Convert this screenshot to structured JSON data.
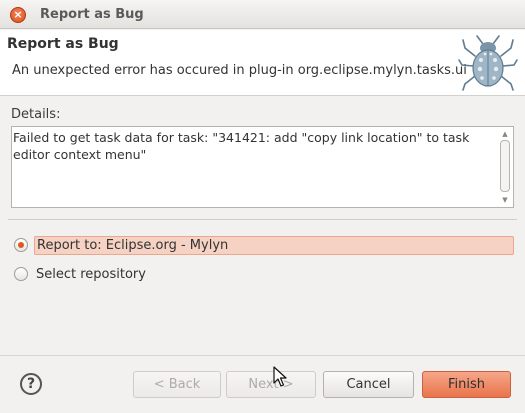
{
  "window": {
    "title": "Report as Bug",
    "close_glyph": "×"
  },
  "banner": {
    "title": "Report as Bug",
    "message": "An unexpected error has occured in plug-in org.eclipse.mylyn.tasks.ui",
    "icon": "bug-icon"
  },
  "details": {
    "label": "Details:",
    "text": "Failed to get task data for task: \"341421: add \"copy link location\" to task editor context menu\""
  },
  "options": [
    {
      "label": "Report to: Eclipse.org - Mylyn",
      "checked": true
    },
    {
      "label": "Select repository",
      "checked": false
    }
  ],
  "buttons": {
    "help_glyph": "?",
    "back": "< Back",
    "next": "Next >",
    "cancel": "Cancel",
    "finish": "Finish"
  },
  "colors": {
    "accent": "#e9744b",
    "selection_bg": "#f5d2c3"
  }
}
